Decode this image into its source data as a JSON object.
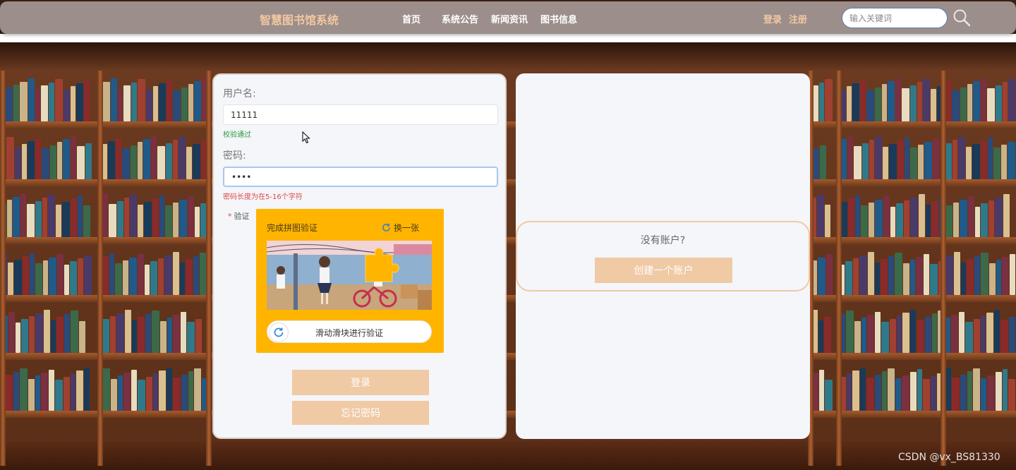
{
  "header": {
    "site_title": "智慧图书馆系统",
    "nav": [
      "首页",
      "系统公告",
      "新闻资讯",
      "图书信息"
    ],
    "login_link": "登录",
    "register_link": "注册",
    "search_placeholder": "输入关键词"
  },
  "login": {
    "username_label": "用户名:",
    "username_value": "11111",
    "username_hint": "校验通过",
    "password_label": "密码:",
    "password_value": "••••",
    "password_hint": "密码长度为在5-16个字符",
    "verify_label": "验证",
    "captcha_title": "完成拼图验证",
    "captcha_refresh": "换一张",
    "slider_text": "滑动滑块进行验证",
    "login_button": "登录",
    "forgot_button": "忘记密码"
  },
  "register": {
    "question": "没有账户?",
    "create_button": "创建一个账户"
  },
  "watermark": "CSDN @vx_BS81330",
  "colors": {
    "header_bg": "#9b8e8b",
    "accent": "#f0c9a5",
    "captcha_bg": "#ffb400",
    "ok": "#2f9a45",
    "error": "#e04848"
  }
}
